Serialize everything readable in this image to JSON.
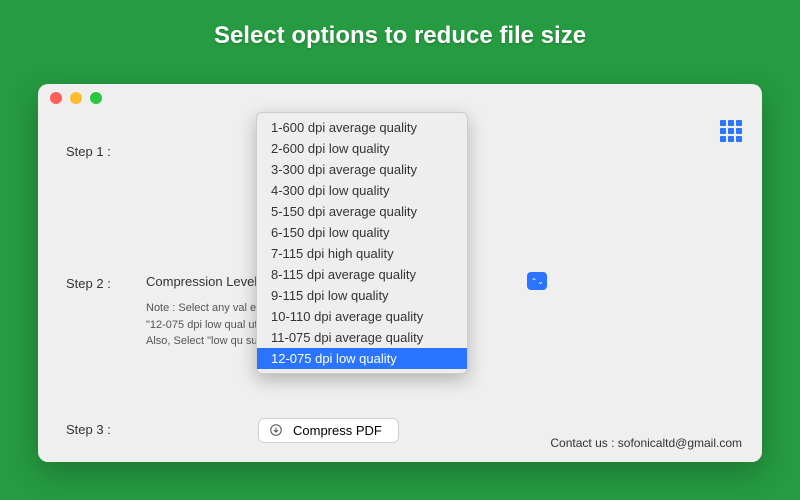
{
  "headline": "Select options to reduce file size",
  "window": {
    "steps": {
      "step1": {
        "label": "Step 1 :"
      },
      "step2": {
        "label": "Step 2 :",
        "field_label": "Compression Level",
        "note_line1": "Note : Select any val                                                            ession, select",
        "note_line2": "\"12-075 dpi low qual                                                            ut resolution of PDF.",
        "note_line3": "Also, Select \"low qu                                                           sults."
      },
      "step3": {
        "label": "Step 3 :",
        "button": "Compress PDF"
      }
    },
    "dropdown": {
      "items": [
        "1-600 dpi average quality",
        "2-600 dpi low quality",
        "3-300 dpi average quality",
        "4-300 dpi low quality",
        "5-150 dpi average quality",
        "6-150 dpi low quality",
        "7-115 dpi high quality",
        "8-115 dpi average quality",
        "9-115 dpi low quality",
        "10-110 dpi average quality",
        "11-075 dpi average quality",
        "12-075 dpi low quality"
      ],
      "selected_index": 11
    },
    "contact_label": "Contact us :",
    "contact_email": "sofonicaltd@gmail.com"
  }
}
